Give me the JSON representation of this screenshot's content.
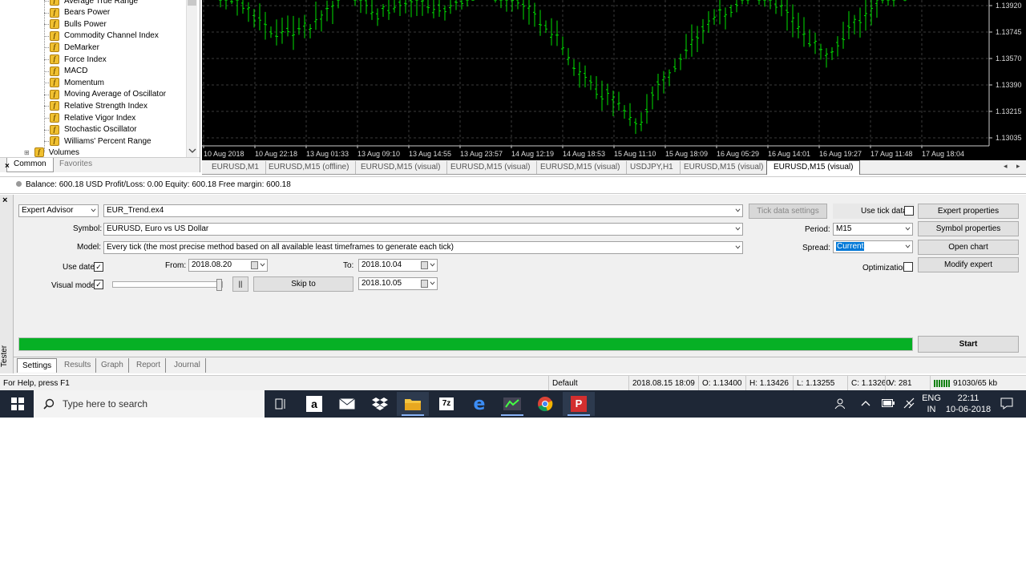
{
  "navigator": {
    "items": [
      {
        "label": "Average True Range"
      },
      {
        "label": "Bears Power"
      },
      {
        "label": "Bulls Power"
      },
      {
        "label": "Commodity Channel Index"
      },
      {
        "label": "DeMarker"
      },
      {
        "label": "Force Index"
      },
      {
        "label": "MACD"
      },
      {
        "label": "Momentum"
      },
      {
        "label": "Moving Average of Oscillator"
      },
      {
        "label": "Relative Strength Index"
      },
      {
        "label": "Relative Vigor Index"
      },
      {
        "label": "Stochastic Oscillator"
      },
      {
        "label": "Williams' Percent Range"
      }
    ],
    "volumes_label": "Volumes",
    "tab_common": "Common",
    "tab_favorites": "Favorites"
  },
  "chart": {
    "price_labels": [
      "1.13920",
      "1.13745",
      "1.13570",
      "1.13390",
      "1.13215",
      "1.13035"
    ],
    "time_labels": [
      "10 Aug 2018",
      "10 Aug 22:18",
      "13 Aug 01:33",
      "13 Aug 09:10",
      "13 Aug 14:55",
      "13 Aug 23:57",
      "14 Aug 12:19",
      "14 Aug 18:53",
      "15 Aug 11:10",
      "15 Aug 18:09",
      "16 Aug 05:29",
      "16 Aug 14:01",
      "16 Aug 19:27",
      "17 Aug 11:48",
      "17 Aug 18:04"
    ],
    "bar_color": "#00e000"
  },
  "chart_tabs": [
    {
      "label": "EURUSD,M1"
    },
    {
      "label": "EURUSD,M15 (offline)"
    },
    {
      "label": "EURUSD,M15 (visual)"
    },
    {
      "label": "EURUSD,M15 (visual)"
    },
    {
      "label": "EURUSD,M15 (visual)"
    },
    {
      "label": "USDJPY,H1"
    },
    {
      "label": "EURUSD,M15 (visual)"
    },
    {
      "label": "EURUSD,M15 (visual)"
    }
  ],
  "account": {
    "text": "Balance: 600.18 USD  Profit/Loss: 0.00  Equity: 600.18  Free margin: 600.18"
  },
  "tester": {
    "side_label": "Tester",
    "type": "Expert Advisor",
    "expert": "EUR_Trend.ex4",
    "tick_data_settings": "Tick data settings",
    "use_tick_data": "Use tick data",
    "expert_properties": "Expert properties",
    "symbol_label": "Symbol:",
    "symbol": "EURUSD, Euro vs US Dollar",
    "period_label": "Period:",
    "period": "M15",
    "symbol_properties": "Symbol properties",
    "model_label": "Model:",
    "model": "Every tick (the most precise method based on all available least timeframes to generate each tick)",
    "spread_label": "Spread:",
    "spread": "Current",
    "open_chart": "Open chart",
    "use_date": "Use date",
    "from_label": "From:",
    "from": "2018.08.20",
    "to_label": "To:",
    "to": "2018.10.04",
    "optimization": "Optimization",
    "modify_expert": "Modify expert",
    "visual_mode": "Visual mode",
    "pause": "||",
    "skip_to": "Skip to",
    "skip_date": "2018.10.05",
    "start": "Start",
    "progress": 1.0,
    "progress_color": "#06b025",
    "tabs": [
      {
        "label": "Settings"
      },
      {
        "label": "Results"
      },
      {
        "label": "Graph"
      },
      {
        "label": "Report"
      },
      {
        "label": "Journal"
      }
    ]
  },
  "status": {
    "help": "For Help, press F1",
    "profile": "Default",
    "datetime": "2018.08.15 18:09",
    "open": "O: 1.13400",
    "high": "H: 1.13426",
    "low": "L: 1.13255",
    "close": "C: 1.13260",
    "volume": "V: 281",
    "traffic": "91030/65 kb"
  },
  "taskbar": {
    "search_placeholder": "Type here to search",
    "lang_line1": "ENG",
    "lang_line2": "IN",
    "time": "22:11",
    "date": "10-06-2018"
  }
}
